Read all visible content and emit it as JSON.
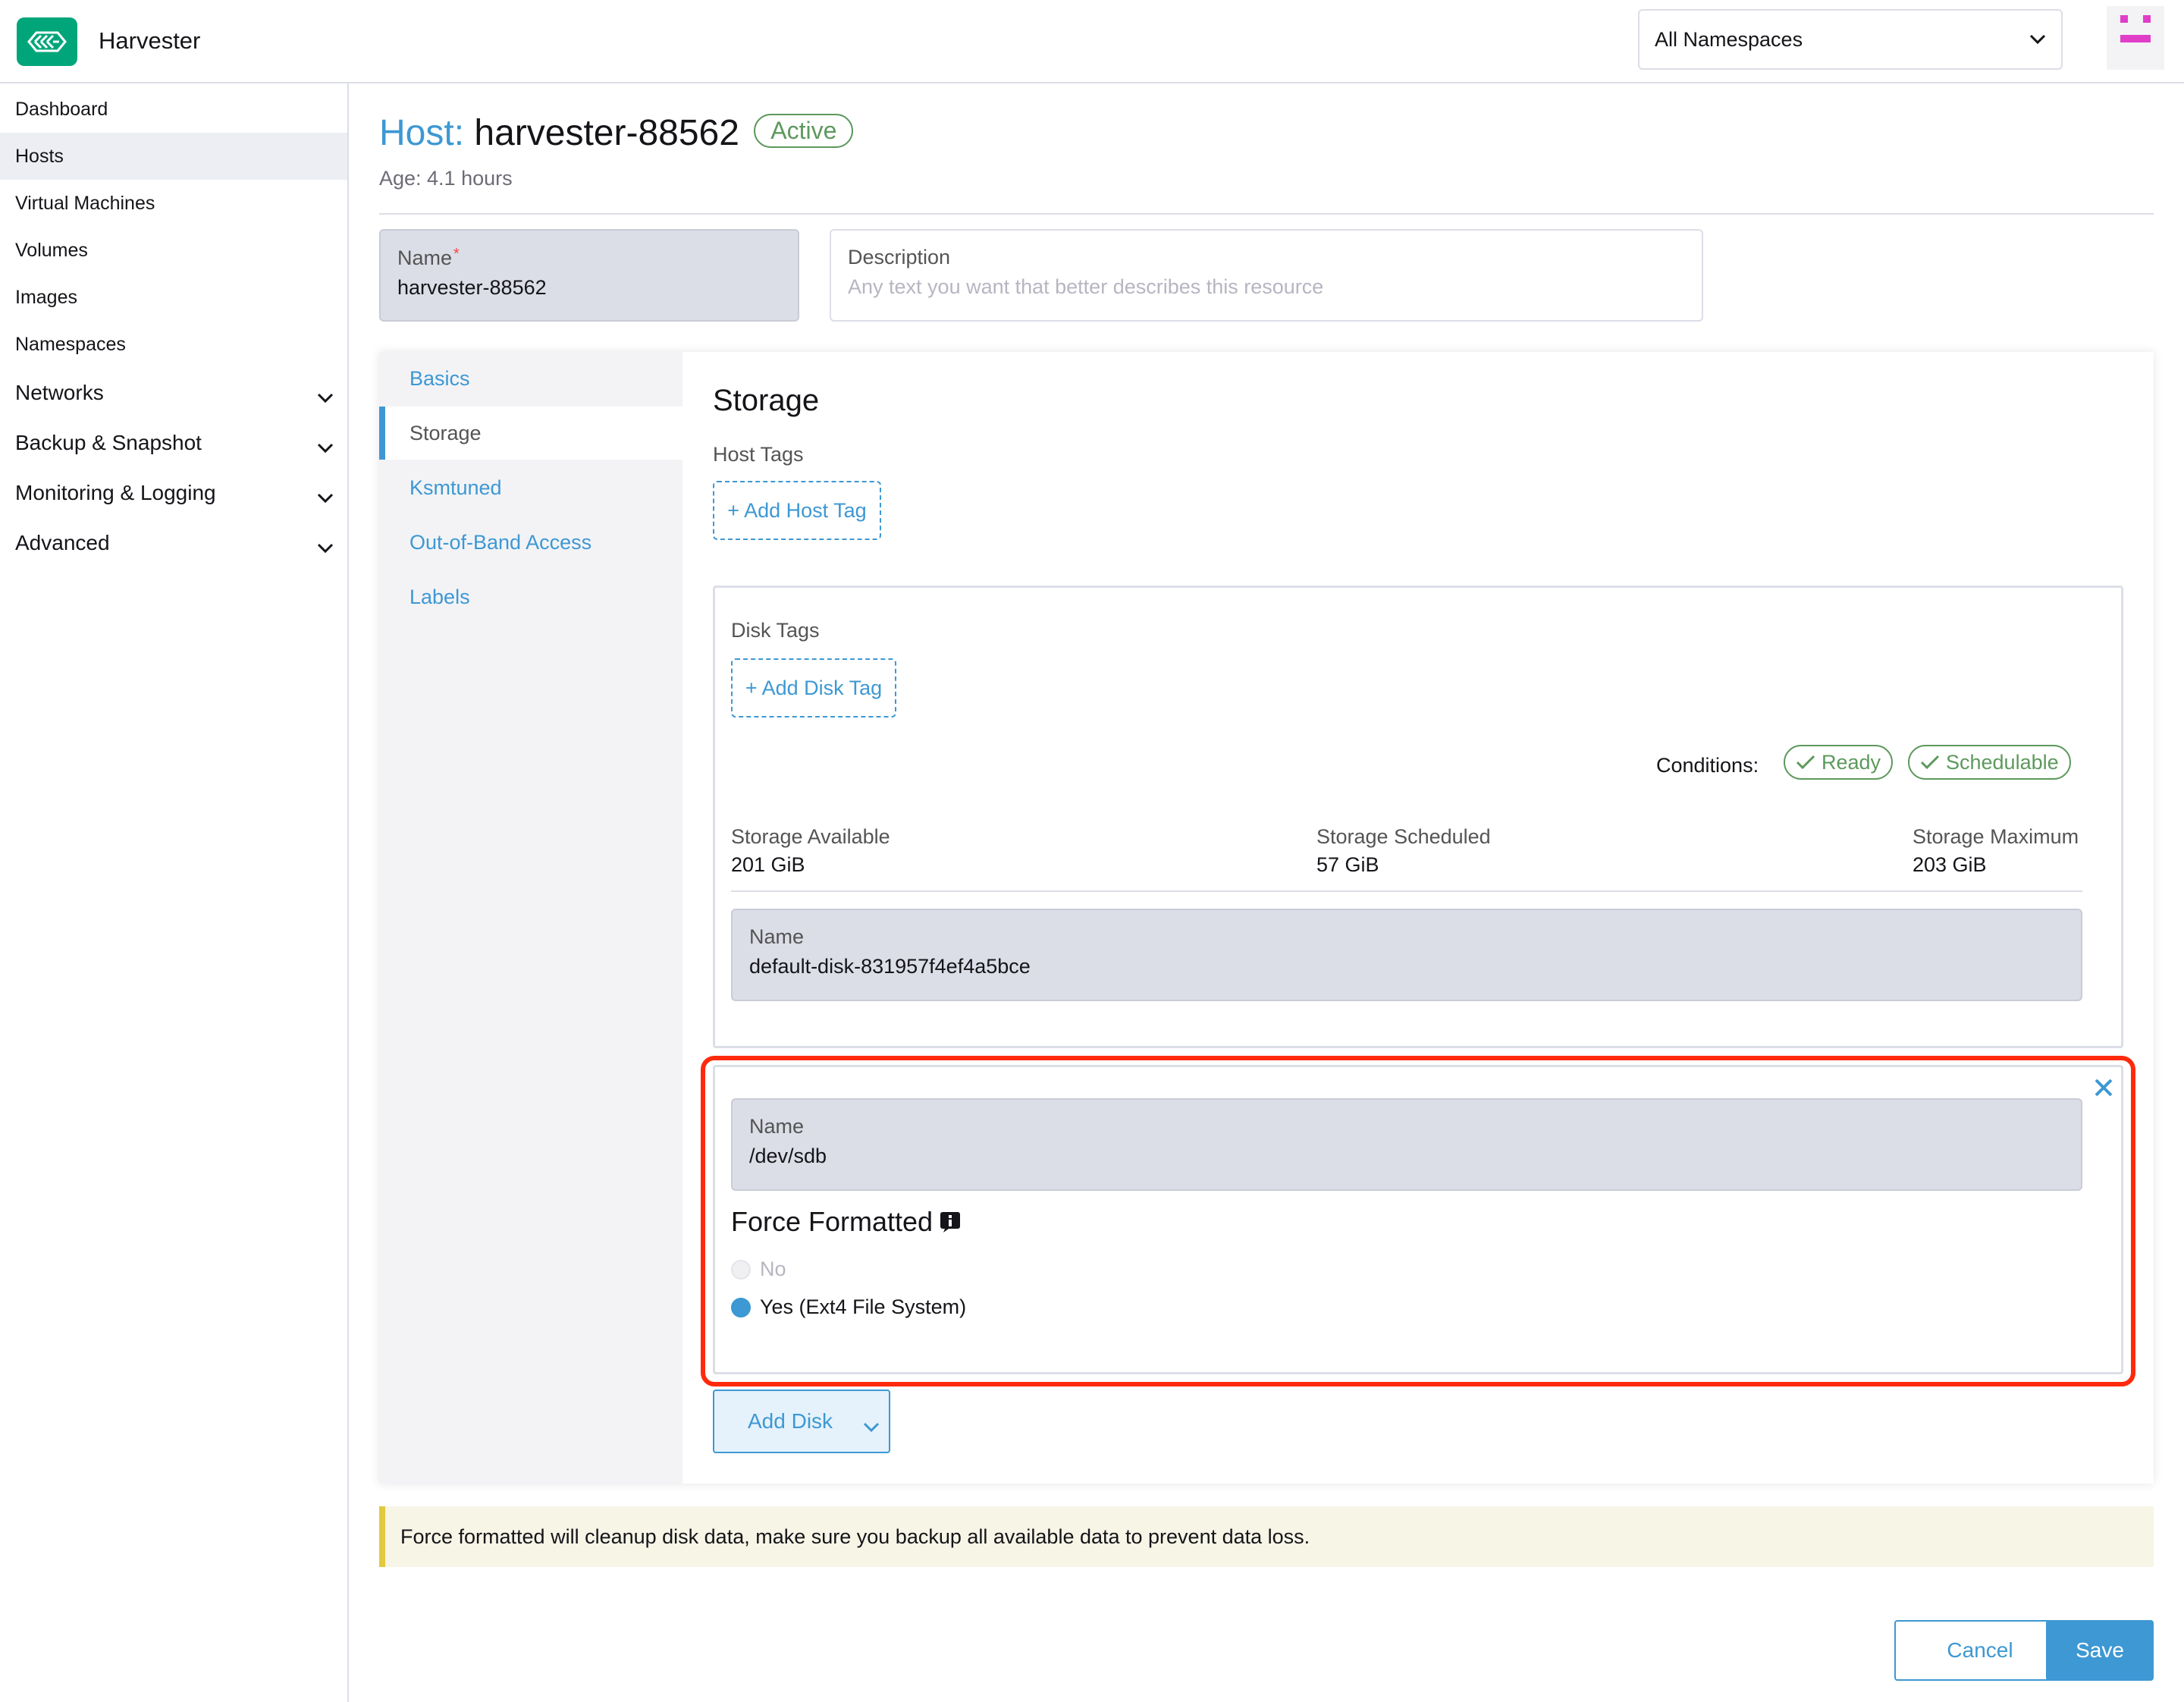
{
  "header": {
    "app_name": "Harvester",
    "namespace_select": "All Namespaces",
    "brand_color": "#00a67a"
  },
  "sidebar": {
    "items": [
      {
        "label": "Dashboard"
      },
      {
        "label": "Hosts",
        "active": true
      },
      {
        "label": "Virtual Machines"
      },
      {
        "label": "Volumes"
      },
      {
        "label": "Images"
      },
      {
        "label": "Namespaces"
      }
    ],
    "groups": [
      {
        "label": "Networks"
      },
      {
        "label": "Backup & Snapshot"
      },
      {
        "label": "Monitoring & Logging"
      },
      {
        "label": "Advanced"
      }
    ]
  },
  "page": {
    "title_prefix": "Host:",
    "title_name": "harvester-88562",
    "status": "Active",
    "age": "Age: 4.1 hours"
  },
  "form": {
    "name_label": "Name",
    "name_required": "*",
    "name_value": "harvester-88562",
    "description_label": "Description",
    "description_placeholder": "Any text you want that better describes this resource"
  },
  "tabs": [
    {
      "label": "Basics"
    },
    {
      "label": "Storage",
      "active": true
    },
    {
      "label": "Ksmtuned"
    },
    {
      "label": "Out-of-Band Access"
    },
    {
      "label": "Labels"
    }
  ],
  "storage": {
    "heading": "Storage",
    "host_tags_label": "Host Tags",
    "add_host_tag": "+ Add Host Tag",
    "existing_disk": {
      "disk_tags_label": "Disk Tags",
      "add_disk_tag": "+ Add Disk Tag",
      "conditions_label": "Conditions:",
      "conditions": [
        "Ready",
        "Schedulable"
      ],
      "stats": [
        {
          "key": "Storage Available",
          "value": "201 GiB"
        },
        {
          "key": "Storage Scheduled",
          "value": "57 GiB"
        },
        {
          "key": "Storage Maximum",
          "value": "203 GiB"
        }
      ],
      "name_label": "Name",
      "name_value": "default-disk-831957f4ef4a5bce"
    },
    "new_disk": {
      "name_label": "Name",
      "name_value": "/dev/sdb",
      "force_formatted_label": "Force Formatted",
      "options": [
        "No",
        "Yes (Ext4 File System)"
      ],
      "selected": "Yes (Ext4 File System)"
    },
    "add_disk": "Add Disk"
  },
  "banner": {
    "text": "Force formatted will cleanup disk data, make sure you backup all available data to prevent data loss."
  },
  "footer": {
    "cancel": "Cancel",
    "save": "Save"
  },
  "colors": {
    "accent": "#3d98d3",
    "success": "#5d995d",
    "highlight": "#ff2a0c",
    "warning": "#e2c93d"
  }
}
